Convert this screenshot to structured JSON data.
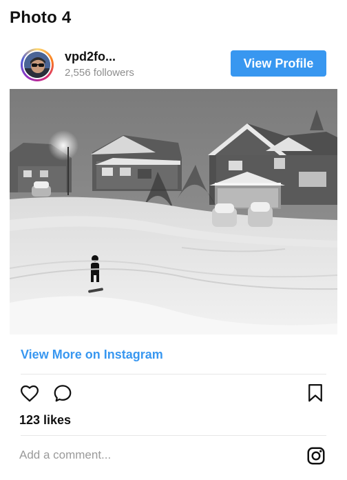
{
  "caption": {
    "title": "Photo 4"
  },
  "profile": {
    "username": "vpd2fo...",
    "followers": "2,556 followers",
    "view_profile_label": "View Profile"
  },
  "post": {
    "photo_icon": "snowy-night-street-photo",
    "view_more_label": "View More on Instagram",
    "likes": "123 likes"
  },
  "actions": {
    "like_icon": "heart-icon",
    "comment_icon": "comment-bubble-icon",
    "save_icon": "bookmark-icon",
    "brand_icon": "instagram-logo-icon"
  },
  "comment": {
    "placeholder": "Add a comment..."
  },
  "colors": {
    "accent": "#3897f0",
    "muted_text": "#8e8e8e",
    "divider": "#e6e6e6"
  }
}
